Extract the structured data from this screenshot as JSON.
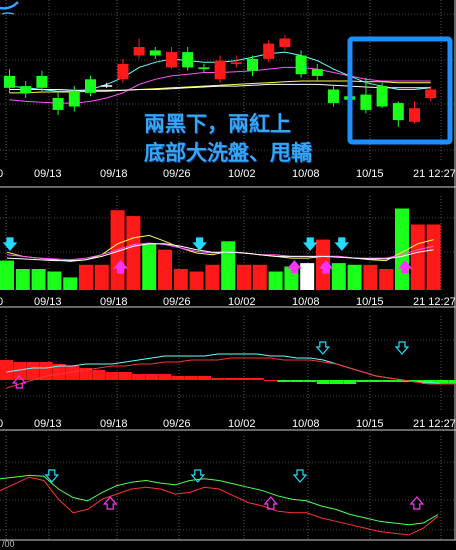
{
  "annotation": {
    "line1": "兩黑下，兩紅上",
    "line2": "底部大洗盤、甩轎"
  },
  "date_axis_labels": [
    "09/13",
    "09/18",
    "09/26",
    "10/02",
    "10/08",
    "10/15",
    "21 12:27"
  ],
  "date_axis_partial_first": "0",
  "corner_label": "/00",
  "colors": {
    "up": "#ff1a1a",
    "down": "#19ff19",
    "highlight_box": "#1e8fff",
    "buy_arrow": "#ff33ff",
    "sell_arrow": "#22ddff"
  },
  "chart_data": [
    {
      "type": "candlestick",
      "panel": "price",
      "candles": [
        {
          "o": 4.2,
          "c": 5.6,
          "h": 6.4,
          "l": 3.6,
          "dir": "down"
        },
        {
          "o": 4.4,
          "c": 3.6,
          "h": 5.0,
          "l": 3.0,
          "dir": "down"
        },
        {
          "o": 4.2,
          "c": 5.6,
          "h": 6.2,
          "l": 3.8,
          "dir": "down"
        },
        {
          "o": 3.0,
          "c": 1.6,
          "h": 3.6,
          "l": 1.0,
          "dir": "down"
        },
        {
          "o": 3.8,
          "c": 2.0,
          "h": 4.4,
          "l": 1.4,
          "dir": "down"
        },
        {
          "o": 5.2,
          "c": 3.6,
          "h": 5.6,
          "l": 3.2,
          "dir": "down"
        },
        {
          "o": 4.4,
          "c": 4.5,
          "h": 4.8,
          "l": 4.2,
          "dir": "doji"
        },
        {
          "o": 5.2,
          "c": 7.0,
          "h": 7.6,
          "l": 4.8,
          "dir": "up"
        },
        {
          "o": 8.0,
          "c": 9.0,
          "h": 10.0,
          "l": 7.6,
          "dir": "up"
        },
        {
          "o": 8.6,
          "c": 8.0,
          "h": 9.0,
          "l": 7.6,
          "dir": "down"
        },
        {
          "o": 6.6,
          "c": 8.4,
          "h": 9.0,
          "l": 6.4,
          "dir": "up"
        },
        {
          "o": 8.4,
          "c": 6.6,
          "h": 9.0,
          "l": 6.2,
          "dir": "down"
        },
        {
          "o": 6.6,
          "c": 6.4,
          "h": 7.0,
          "l": 6.0,
          "dir": "down"
        },
        {
          "o": 5.2,
          "c": 7.4,
          "h": 8.0,
          "l": 4.8,
          "dir": "up"
        },
        {
          "o": 7.0,
          "c": 7.2,
          "h": 8.0,
          "l": 6.6,
          "dir": "up"
        },
        {
          "o": 7.6,
          "c": 6.2,
          "h": 8.0,
          "l": 5.6,
          "dir": "down"
        },
        {
          "o": 7.6,
          "c": 9.4,
          "h": 9.8,
          "l": 7.2,
          "dir": "up"
        },
        {
          "o": 9.0,
          "c": 10.0,
          "h": 10.4,
          "l": 8.6,
          "dir": "up"
        },
        {
          "o": 8.0,
          "c": 5.8,
          "h": 8.6,
          "l": 5.4,
          "dir": "down"
        },
        {
          "o": 6.4,
          "c": 5.6,
          "h": 7.0,
          "l": 5.0,
          "dir": "down"
        },
        {
          "o": 4.0,
          "c": 2.4,
          "h": 4.4,
          "l": 2.0,
          "dir": "down"
        },
        {
          "o": 3.2,
          "c": 2.8,
          "h": 3.6,
          "l": 2.4,
          "dir": "down"
        },
        {
          "o": 3.4,
          "c": 1.6,
          "h": 5.4,
          "l": 1.2,
          "dir": "down"
        },
        {
          "o": 4.4,
          "c": 2.0,
          "h": 4.8,
          "l": 1.8,
          "dir": "down"
        },
        {
          "o": 2.4,
          "c": 0.4,
          "h": 2.6,
          "l": -0.4,
          "dir": "down"
        },
        {
          "o": 0.2,
          "c": 1.8,
          "h": 2.6,
          "l": 0.0,
          "dir": "up"
        },
        {
          "o": 3.0,
          "c": 4.0,
          "h": 4.4,
          "l": 2.6,
          "dir": "up"
        }
      ],
      "ma_lines": [
        {
          "color": "#ffff55",
          "values": [
            3.6,
            3.6,
            3.7,
            3.7,
            3.7,
            3.8,
            3.8,
            3.9,
            4.0,
            4.1,
            4.2,
            4.3,
            4.4,
            4.5,
            4.6,
            4.7,
            4.8,
            4.9,
            5.0,
            5.0,
            5.0,
            5.0,
            4.9,
            4.9,
            4.8,
            4.8,
            4.8
          ]
        },
        {
          "color": "#ff55ff",
          "values": [
            2.8,
            2.6,
            2.5,
            2.4,
            2.4,
            2.6,
            3.0,
            3.6,
            4.6,
            5.2,
            5.6,
            5.8,
            6.0,
            6.0,
            6.1,
            6.2,
            6.4,
            6.6,
            6.6,
            6.4,
            6.0,
            5.6,
            5.2,
            5.0,
            5.0,
            5.0,
            5.0
          ]
        },
        {
          "color": "#66ffff",
          "values": [
            4.4,
            4.2,
            4.0,
            3.8,
            3.8,
            4.0,
            4.6,
            5.4,
            6.6,
            7.2,
            7.6,
            7.4,
            7.2,
            7.2,
            7.4,
            7.8,
            8.2,
            8.4,
            8.0,
            7.4,
            6.4,
            5.6,
            4.8,
            4.4,
            4.0,
            4.0,
            4.2
          ]
        },
        {
          "color": "#ffffff",
          "values": [
            4.0,
            4.0,
            4.0,
            4.0,
            3.9,
            3.9,
            3.9,
            3.9,
            4.0,
            4.0,
            4.1,
            4.2,
            4.3,
            4.4,
            4.4,
            4.5,
            4.6,
            4.6,
            4.6,
            4.6,
            4.5,
            4.4,
            4.3,
            4.2,
            4.2,
            4.2,
            4.2
          ]
        }
      ]
    },
    {
      "type": "bar",
      "panel": "indicator-1",
      "ylim": [
        0,
        100
      ],
      "bars": [
        {
          "v": 35,
          "dir": "down"
        },
        {
          "v": 25,
          "dir": "down"
        },
        {
          "v": 25,
          "dir": "down"
        },
        {
          "v": 22,
          "dir": "down"
        },
        {
          "v": 15,
          "dir": "down"
        },
        {
          "v": 30,
          "dir": "up"
        },
        {
          "v": 30,
          "dir": "up"
        },
        {
          "v": 95,
          "dir": "up"
        },
        {
          "v": 88,
          "dir": "up"
        },
        {
          "v": 55,
          "dir": "down"
        },
        {
          "v": 48,
          "dir": "up"
        },
        {
          "v": 25,
          "dir": "up"
        },
        {
          "v": 22,
          "dir": "up"
        },
        {
          "v": 30,
          "dir": "up"
        },
        {
          "v": 58,
          "dir": "down"
        },
        {
          "v": 30,
          "dir": "up"
        },
        {
          "v": 30,
          "dir": "up"
        },
        {
          "v": 22,
          "dir": "down"
        },
        {
          "v": 28,
          "dir": "down"
        },
        {
          "v": 32,
          "dir": "white"
        },
        {
          "v": 60,
          "dir": "up"
        },
        {
          "v": 32,
          "dir": "down"
        },
        {
          "v": 30,
          "dir": "down"
        },
        {
          "v": 30,
          "dir": "up"
        },
        {
          "v": 25,
          "dir": "up"
        },
        {
          "v": 97,
          "dir": "down"
        },
        {
          "v": 78,
          "dir": "up"
        },
        {
          "v": 78,
          "dir": "up"
        }
      ],
      "lines": [
        {
          "color": "#ffff55",
          "values": [
            45,
            40,
            38,
            36,
            34,
            36,
            42,
            55,
            62,
            65,
            58,
            50,
            44,
            42,
            46,
            44,
            42,
            40,
            38,
            38,
            40,
            40,
            38,
            36,
            35,
            45,
            55,
            60
          ]
        },
        {
          "color": "#ff55ff",
          "values": [
            42,
            40,
            38,
            37,
            36,
            38,
            42,
            48,
            54,
            56,
            54,
            50,
            46,
            44,
            46,
            44,
            42,
            42,
            40,
            40,
            40,
            40,
            38,
            38,
            38,
            42,
            48,
            52
          ]
        },
        {
          "color": "#ffffff",
          "values": [
            38,
            37,
            36,
            35,
            35,
            36,
            40,
            46,
            52,
            55,
            55,
            52,
            48,
            45,
            45,
            44,
            42,
            40,
            40,
            40,
            40,
            39,
            38,
            37,
            37,
            40,
            45,
            48
          ]
        }
      ],
      "sell_arrow_at": [
        0,
        12,
        19,
        21
      ],
      "buy_arrow_at": [
        7,
        18,
        20,
        25
      ]
    },
    {
      "type": "bar",
      "panel": "indicator-2",
      "ylim": [
        -10,
        30
      ],
      "bars": [
        10,
        9,
        9,
        9,
        8,
        7,
        6,
        5,
        4,
        4,
        3,
        3,
        3,
        2,
        2,
        2,
        1,
        1,
        1,
        1,
        0,
        -1,
        -1,
        -1,
        -2,
        -2,
        -2,
        -1,
        -1,
        -1,
        -1,
        -1,
        -2,
        -2,
        -2
      ],
      "lines": [
        {
          "color": "#66ffff",
          "values": [
            4,
            5,
            6,
            6,
            7,
            7,
            8,
            8,
            8,
            9,
            10,
            11,
            12,
            12,
            12,
            12,
            13,
            13,
            13,
            13,
            12,
            12,
            11,
            11,
            10,
            8,
            6,
            4,
            2,
            1,
            0,
            -1,
            -1,
            -2,
            -2
          ]
        },
        {
          "color": "#ff3333",
          "values": [
            -4,
            -2,
            0,
            2,
            3,
            4,
            5,
            6,
            7,
            7,
            8,
            8,
            9,
            9,
            10,
            10,
            10,
            11,
            11,
            11,
            11,
            10,
            10,
            10,
            9,
            8,
            6,
            4,
            2,
            1,
            0,
            -1,
            -2,
            -2,
            -2
          ]
        }
      ],
      "sell_arrow_at": [
        24,
        30
      ],
      "buy_arrow_at": [
        1
      ]
    },
    {
      "type": "line",
      "panel": "indicator-3",
      "ylim": [
        0,
        100
      ],
      "lines": [
        {
          "color": "#55ff55",
          "values": [
            72,
            74,
            76,
            75,
            60,
            50,
            46,
            56,
            64,
            68,
            70,
            67,
            65,
            70,
            72,
            70,
            66,
            62,
            58,
            52,
            48,
            46,
            40,
            36,
            30,
            26,
            22,
            20,
            18,
            20,
            30
          ]
        },
        {
          "color": "#ff3333",
          "values": [
            58,
            66,
            74,
            70,
            48,
            32,
            36,
            48,
            54,
            60,
            62,
            60,
            54,
            56,
            62,
            60,
            52,
            44,
            40,
            34,
            32,
            32,
            26,
            22,
            18,
            14,
            10,
            8,
            6,
            14,
            28
          ]
        }
      ],
      "sell_arrow_at": [
        3,
        13,
        20
      ],
      "buy_arrow_at": [
        7,
        18,
        28
      ]
    }
  ]
}
